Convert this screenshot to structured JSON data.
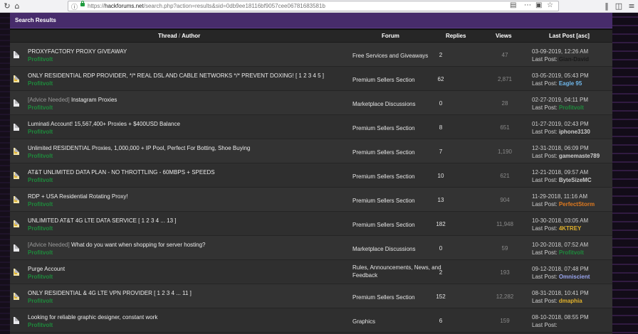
{
  "browser": {
    "url_prefix": "https://",
    "url_host": "hackforums.net",
    "url_path": "/search.php?action=results&sid=0db9ee18116bf9057cee06781683581b"
  },
  "section_title": "Search Results",
  "columns": {
    "thread": "Thread",
    "slash": "/",
    "author": "Author",
    "forum": "Forum",
    "replies": "Replies",
    "views": "Views",
    "last_post": "Last Post",
    "sort": "[asc]"
  },
  "last_post_prefix": "Last Post:",
  "colors": {
    "header_bg": "#472c6b",
    "author_green": "#1e8a3c",
    "row_bg": "#333333"
  },
  "threads": [
    {
      "prefix": "",
      "title": "PROXYFACTORY PROXY GIVEAWAY",
      "author": "Profitvolt",
      "forum": "Free Services and Giveaways",
      "replies": "2",
      "views": "47",
      "date": "03-09-2019, 12:26 AM",
      "user": "Gian-David",
      "user_color": "#1a1a1a",
      "icon": "plain"
    },
    {
      "prefix": "",
      "title": "ONLY RESIDENTIAL RDP PROVIDER, */* REAL DSL AND CABLE NETWORKS */* PREVENT DOXING! [ 1 2 3 4 5 ]",
      "author": "Profitvolt",
      "forum": "Premium Sellers Section",
      "replies": "62",
      "views": "2,871",
      "date": "03-05-2019, 05:43 PM",
      "user": "Eagle 95",
      "user_color": "#6fb7ea",
      "icon": "hot"
    },
    {
      "prefix": "[Advice Needed]",
      "title": "Instagram Proxies",
      "author": "Profitvolt",
      "forum": "Marketplace Discussions",
      "replies": "0",
      "views": "28",
      "date": "02-27-2019, 04:11 PM",
      "user": "Profitvolt",
      "user_color": "#1e8a3c",
      "icon": "plain"
    },
    {
      "prefix": "",
      "title": "Luminati Account! 15,567,400+ Proxies + $400USD Balance",
      "author": "Profitvolt",
      "forum": "Premium Sellers Section",
      "replies": "8",
      "views": "651",
      "date": "01-27-2019, 02:43 PM",
      "user": "iphone3130",
      "user_color": "#cfcfcf",
      "icon": "plain"
    },
    {
      "prefix": "",
      "title": "Unlimited RESIDENTIAL Proxies, 1,000,000 + IP Pool, Perfect For Botting, Shoe Buying",
      "author": "Profitvolt",
      "forum": "Premium Sellers Section",
      "replies": "7",
      "views": "1,190",
      "date": "12-31-2018, 06:09 PM",
      "user": "gamemaste789",
      "user_color": "#cfcfcf",
      "icon": "hot"
    },
    {
      "prefix": "",
      "title": "AT&T UNLIMITED DATA PLAN - NO THROTTLING - 60MBPS + SPEEDS",
      "author": "Profitvolt",
      "forum": "Premium Sellers Section",
      "replies": "10",
      "views": "621",
      "date": "12-21-2018, 09:57 AM",
      "user": "ByteSizeMC",
      "user_color": "#cfcfcf",
      "icon": "hot"
    },
    {
      "prefix": "",
      "title": "RDP + USA Residential Rotating Proxy!",
      "author": "Profitvolt",
      "forum": "Premium Sellers Section",
      "replies": "13",
      "views": "904",
      "date": "11-29-2018, 11:16 AM",
      "user": "PerfectStorm",
      "user_color": "#e07a1f",
      "icon": "hot"
    },
    {
      "prefix": "",
      "title": "UNLIMITED AT&T 4G LTE DATA SERVICE [ 1 2 3 4 ... 13 ]",
      "author": "Profitvolt",
      "forum": "Premium Sellers Section",
      "replies": "182",
      "views": "11,948",
      "date": "10-30-2018, 03:05 AM",
      "user": "4KTREY",
      "user_color": "#e0b12b",
      "icon": "hot"
    },
    {
      "prefix": "[Advice Needed]",
      "title": "What do you want when shopping for server hosting?",
      "author": "Profitvolt",
      "forum": "Marketplace Discussions",
      "replies": "0",
      "views": "59",
      "date": "10-20-2018, 07:52 AM",
      "user": "Profitvolt",
      "user_color": "#1e8a3c",
      "icon": "plain"
    },
    {
      "prefix": "",
      "title": "Purge Account",
      "author": "Profitvolt",
      "forum": "Rules, Announcements, News, and Feedback",
      "replies": "2",
      "views": "193",
      "date": "09-12-2018, 07:48 PM",
      "user": "Omniscient",
      "user_color": "#9aa6f0",
      "icon": "hot"
    },
    {
      "prefix": "",
      "title": "ONLY RESIDENTIAL & 4G LTE VPN PROVIDER [ 1 2 3 4 ... 11 ]",
      "author": "Profitvolt",
      "forum": "Premium Sellers Section",
      "replies": "152",
      "views": "12,282",
      "date": "08-31-2018, 10:41 PM",
      "user": "dmaphia",
      "user_color": "#e0b12b",
      "icon": "hot"
    },
    {
      "prefix": "",
      "title": "Looking for reliable graphic designer, constant work",
      "author": "Profitvolt",
      "forum": "Graphics",
      "replies": "6",
      "views": "159",
      "date": "08-10-2018, 08:55 PM",
      "user": "",
      "user_color": "#cfcfcf",
      "icon": "plain"
    }
  ]
}
